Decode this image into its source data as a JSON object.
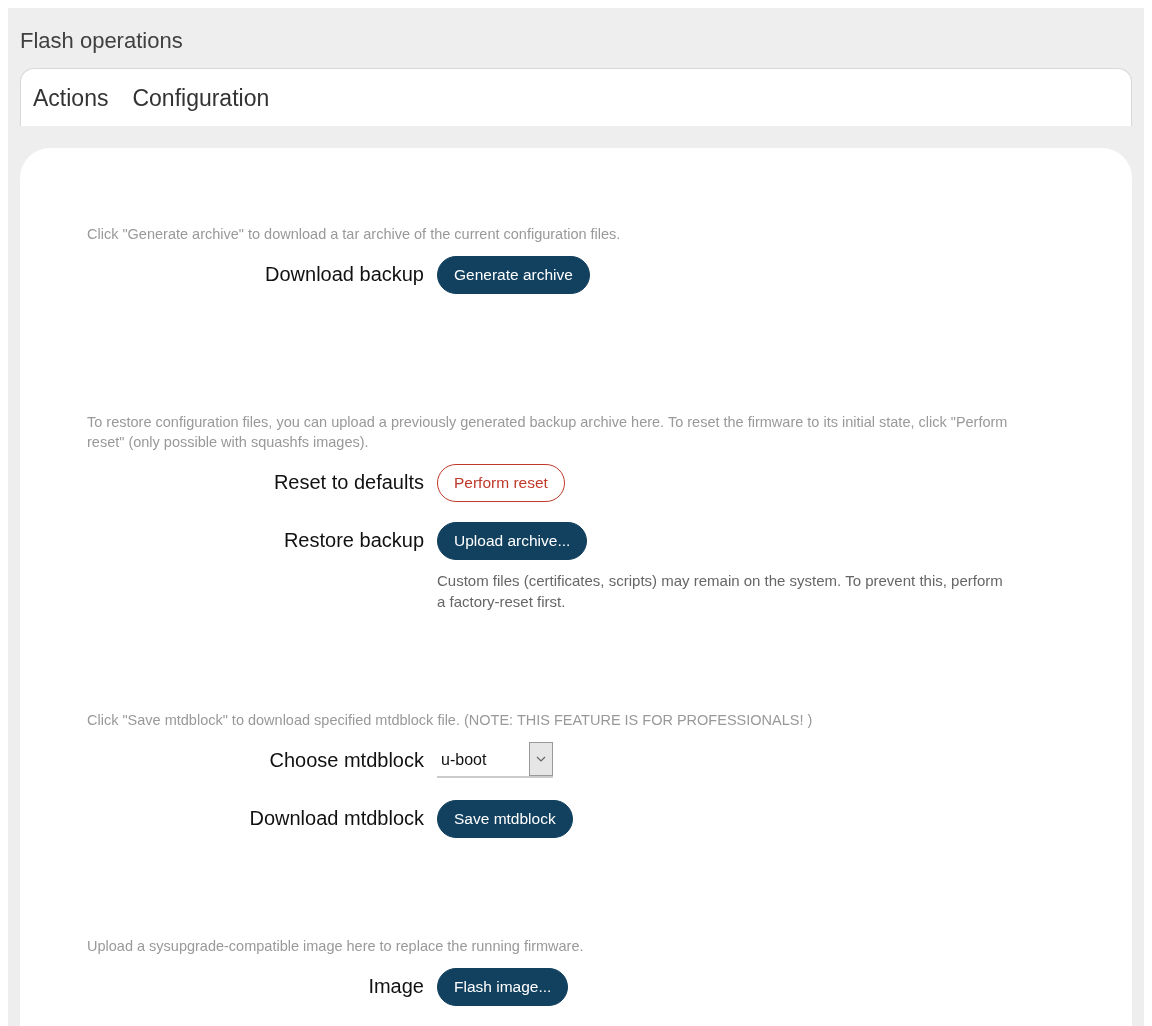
{
  "title": "Flash operations",
  "tabs": [
    {
      "label": "Actions"
    },
    {
      "label": "Configuration"
    }
  ],
  "sections": [
    {
      "description": "Click \"Generate archive\" to download a tar archive of the current configuration files.",
      "rows": [
        {
          "label": "Download backup",
          "kind": "button",
          "text": "Generate archive"
        }
      ]
    },
    {
      "description": "To restore configuration files, you can upload a previously generated backup archive here. To reset the firmware to its initial state, click \"Perform reset\" (only possible with squashfs images).",
      "rows": [
        {
          "label": "Reset to defaults",
          "kind": "danger-button",
          "text": "Perform reset"
        },
        {
          "label": "Restore backup",
          "kind": "button",
          "text": "Upload archive...",
          "help": "Custom files (certificates, scripts) may remain on the system. To prevent this, perform a factory-reset first."
        }
      ]
    },
    {
      "description": "Click \"Save mtdblock\" to download specified mtdblock file. (NOTE: THIS FEATURE IS FOR PROFESSIONALS! )",
      "rows": [
        {
          "label": "Choose mtdblock",
          "kind": "select",
          "text": "u-boot"
        },
        {
          "label": "Download mtdblock",
          "kind": "button",
          "text": "Save mtdblock"
        }
      ]
    },
    {
      "description": "Upload a sysupgrade-compatible image here to replace the running firmware.",
      "rows": [
        {
          "label": "Image",
          "kind": "button",
          "text": "Flash image..."
        }
      ]
    }
  ]
}
